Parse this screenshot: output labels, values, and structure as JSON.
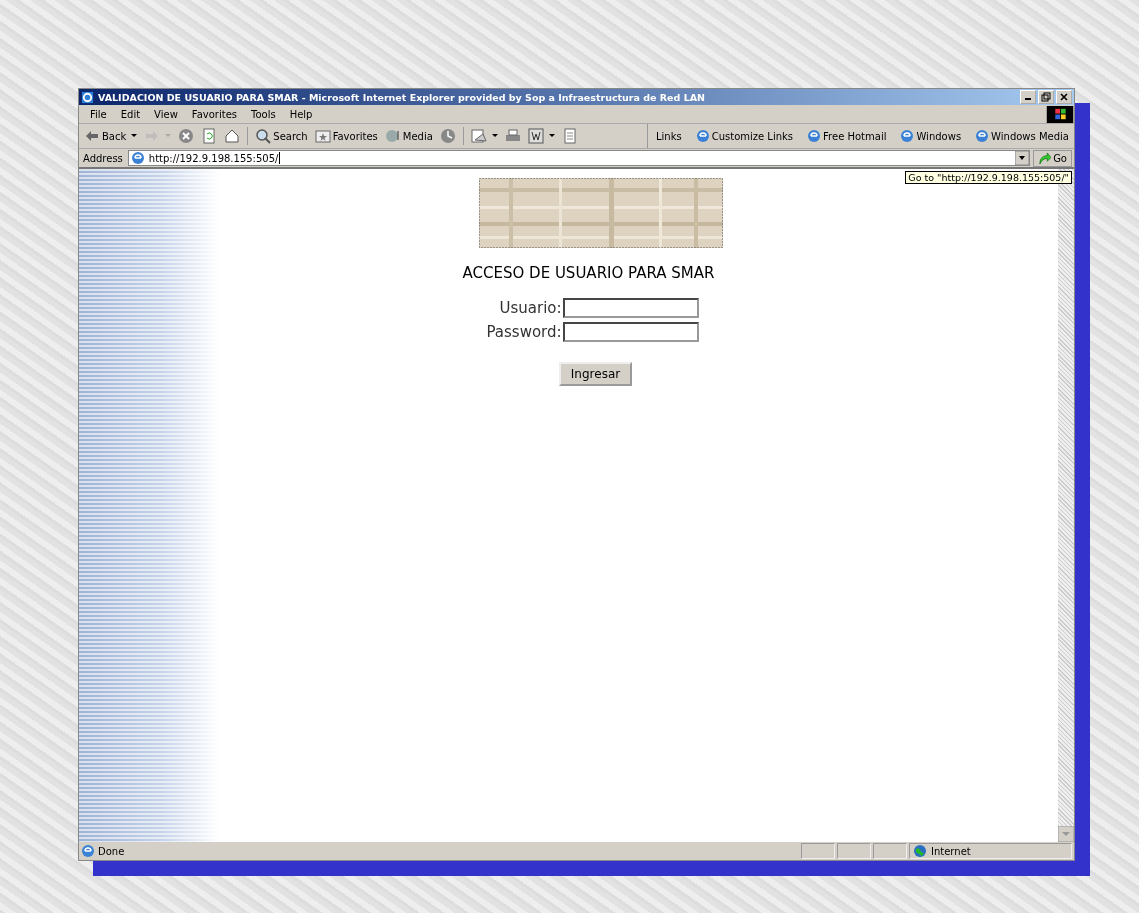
{
  "window": {
    "title": "VALIDACION DE USUARIO PARA SMAR - Microsoft Internet Explorer provided by Sop a Infraestructura de Red LAN"
  },
  "menu": [
    "File",
    "Edit",
    "View",
    "Favorites",
    "Tools",
    "Help"
  ],
  "toolbar": [
    {
      "kind": "back",
      "label": "Back",
      "dropdown": true,
      "disabled": false
    },
    {
      "kind": "forward",
      "dropdown": true,
      "disabled": true
    },
    {
      "kind": "stop",
      "dropdown": false,
      "disabled": false
    },
    {
      "kind": "refresh",
      "dropdown": false,
      "disabled": false
    },
    {
      "kind": "home",
      "dropdown": false,
      "disabled": false
    },
    {
      "kind": "search",
      "label": "Search",
      "dropdown": false,
      "disabled": false
    },
    {
      "kind": "favorites",
      "label": "Favorites",
      "dropdown": false,
      "disabled": false
    },
    {
      "kind": "media",
      "label": "Media",
      "dropdown": false,
      "disabled": false
    },
    {
      "kind": "history",
      "dropdown": false,
      "disabled": false
    },
    {
      "kind": "mail",
      "dropdown": true,
      "disabled": false
    },
    {
      "kind": "print",
      "dropdown": false,
      "disabled": false
    },
    {
      "kind": "edit",
      "dropdown": true,
      "disabled": false
    },
    {
      "kind": "discuss",
      "dropdown": false,
      "disabled": false
    }
  ],
  "links": {
    "label": "Links",
    "items": [
      "Customize Links",
      "Free Hotmail",
      "Windows",
      "Windows Media"
    ]
  },
  "address": {
    "label": "Address",
    "value": "http://192.9.198.155:505/",
    "go": "Go",
    "tooltip": "Go to \"http://192.9.198.155:505/\""
  },
  "page": {
    "heading": "ACCESO DE USUARIO PARA SMAR",
    "fields": [
      {
        "label": "Usuario:"
      },
      {
        "label": "Password:"
      }
    ],
    "button": "Ingresar"
  },
  "status_bar": {
    "text": "Done",
    "zone": "Internet"
  }
}
